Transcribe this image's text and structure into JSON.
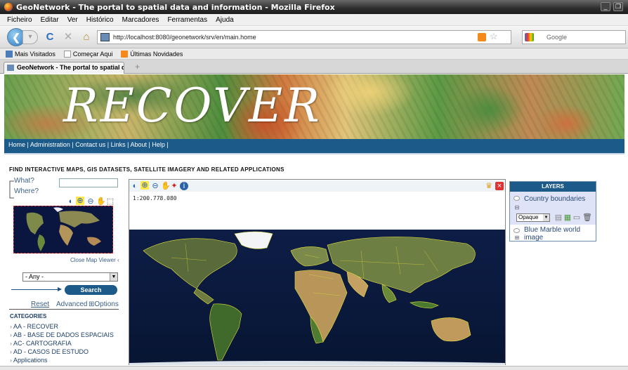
{
  "window": {
    "title": "GeoNetwork - The portal to spatial data and information - Mozilla Firefox",
    "min_glyph": "_",
    "restore_glyph": "❐"
  },
  "menu": {
    "items": [
      "Ficheiro",
      "Editar",
      "Ver",
      "Histórico",
      "Marcadores",
      "Ferramentas",
      "Ajuda"
    ]
  },
  "navbar": {
    "back_icon": "❮",
    "forward_icon": "▾",
    "reload_icon": "C",
    "stop_icon": "✕",
    "home_icon": "⌂",
    "url": "http://localhost:8080/geonetwork/srv/en/main.home",
    "star_icon": "☆",
    "search_placeholder": "Google"
  },
  "bookmarks": [
    "Mais Visitados",
    "Começar Aqui",
    "Últimas Novidades"
  ],
  "tab": {
    "label": "GeoNetwork - The portal to spatial d...",
    "new_tab": "+"
  },
  "banner": {
    "title": "RECOVER"
  },
  "nav_links": {
    "items": [
      "Home",
      "Administration",
      "Contact us",
      "Links",
      "About",
      "Help"
    ],
    "separator": " | "
  },
  "headline": "FIND INTERACTIVE MAPS, GIS DATASETS, SATELLITE IMAGERY AND RELATED APPLICATIONS",
  "search": {
    "what_label": "What?",
    "where_label": "Where?",
    "what_value": "",
    "close_map": "Close Map Viewer ‹",
    "any_option": "- Any -",
    "search_button": "Search",
    "reset": "Reset",
    "advanced": "Advanced",
    "options": "⊞Options"
  },
  "categories": {
    "heading": "CATEGORIES",
    "items": [
      "AA - RECOVER",
      "AB - BASE DE DADOS ESPACIAIS",
      "AC- CARTOGRAFIA",
      "AD - CASOS DE ESTUDO",
      "Applications"
    ]
  },
  "map": {
    "scale": "1:200.778.080"
  },
  "layers": {
    "heading": "LAYERS",
    "items": [
      {
        "name": "Country boundaries",
        "opacity": "Opaque"
      },
      {
        "name": "Blue Marble world image"
      }
    ]
  },
  "colors": {
    "brand_blue": "#1c5a8a",
    "link_blue": "#3b5f85",
    "layer_selected_bg": "#dfe3f7"
  }
}
